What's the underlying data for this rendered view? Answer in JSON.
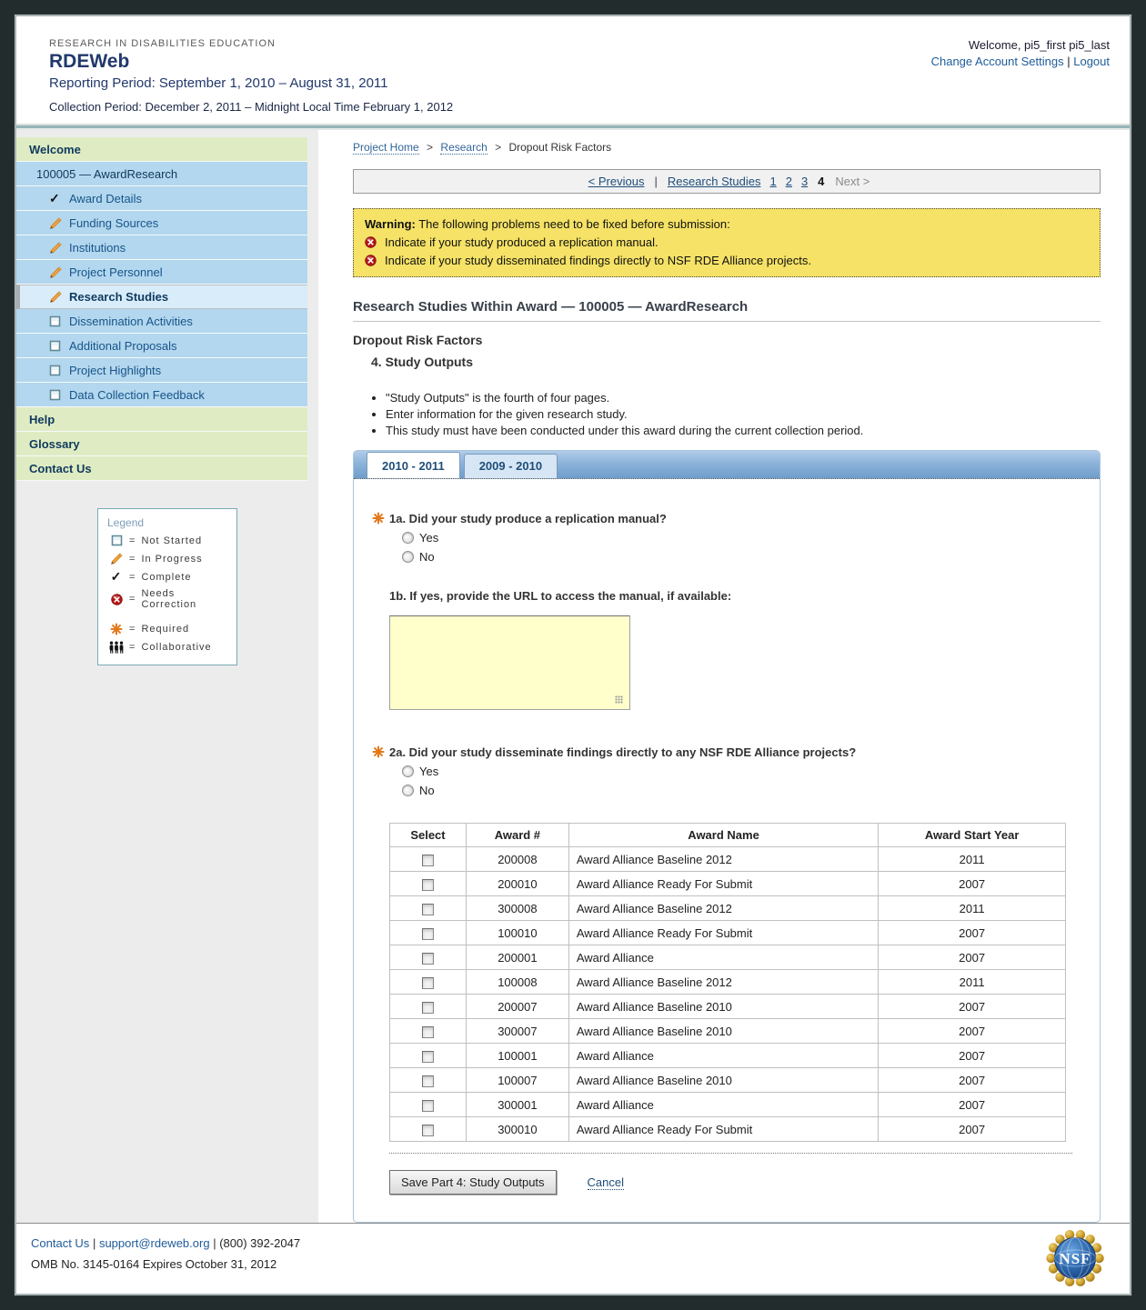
{
  "header": {
    "eyebrow": "RESEARCH IN DISABILITIES EDUCATION",
    "app_title": "RDEWeb",
    "reporting_period": "Reporting Period: September 1, 2010 – August 31, 2011",
    "collection_period": "Collection Period: December 2, 2011 – Midnight Local Time February 1, 2012",
    "welcome": "Welcome, pi5_first pi5_last",
    "account_settings_link": "Change Account Settings",
    "link_separator": "|",
    "logout_link": "Logout"
  },
  "sidebar": {
    "items": [
      {
        "label": "Welcome",
        "type": "section"
      },
      {
        "label": "100005 — AwardResearch",
        "type": "award"
      },
      {
        "label": "Award Details",
        "type": "sub",
        "icon": "complete"
      },
      {
        "label": "Funding Sources",
        "type": "sub",
        "icon": "in-progress"
      },
      {
        "label": "Institutions",
        "type": "sub",
        "icon": "in-progress"
      },
      {
        "label": "Project Personnel",
        "type": "sub",
        "icon": "in-progress"
      },
      {
        "label": "Research Studies",
        "type": "sub",
        "icon": "in-progress",
        "selected": true
      },
      {
        "label": "Dissemination Activities",
        "type": "sub",
        "icon": "not-started"
      },
      {
        "label": "Additional Proposals",
        "type": "sub",
        "icon": "not-started"
      },
      {
        "label": "Project Highlights",
        "type": "sub",
        "icon": "not-started"
      },
      {
        "label": "Data Collection Feedback",
        "type": "sub",
        "icon": "not-started"
      },
      {
        "label": "Help",
        "type": "section"
      },
      {
        "label": "Glossary",
        "type": "section"
      },
      {
        "label": "Contact Us",
        "type": "section"
      }
    ]
  },
  "legend": {
    "title": "Legend",
    "equals": "=",
    "items": [
      {
        "icon": "not-started",
        "label": "Not Started",
        "gap": false
      },
      {
        "icon": "in-progress",
        "label": "In Progress",
        "gap": false
      },
      {
        "icon": "complete",
        "label": "Complete",
        "gap": false
      },
      {
        "icon": "needs-correction",
        "label": "Needs Correction",
        "gap": false
      },
      {
        "icon": "required",
        "label": "Required",
        "gap": true
      },
      {
        "icon": "collaborative",
        "label": "Collaborative",
        "gap": false
      }
    ]
  },
  "breadcrumb": {
    "home": "Project Home",
    "research": "Research",
    "separator": ">",
    "current": "Dropout Risk Factors"
  },
  "pagination": {
    "previous": "< Previous",
    "pipe": "|",
    "studies_link": "Research Studies",
    "pages": [
      "1",
      "2",
      "3"
    ],
    "current_page": "4",
    "next": "Next >"
  },
  "warning": {
    "title": "Warning:",
    "intro": " The following problems need to be fixed before submission:",
    "items": [
      "Indicate if your study produced a replication manual.",
      "Indicate if your study disseminated findings directly to NSF RDE Alliance projects."
    ]
  },
  "main": {
    "section_title": "Research Studies Within Award — 100005 — AwardResearch",
    "study_title": "Dropout Risk Factors",
    "page_part_title": "4. Study Outputs",
    "bullets": [
      "\"Study Outputs\" is the fourth of four pages.",
      "Enter information for the given research study.",
      "This study must have been conducted under this award during the current collection period."
    ],
    "tabs": [
      {
        "label": "2010 - 2011",
        "active": true
      },
      {
        "label": "2009 - 2010",
        "active": false
      }
    ],
    "q1a": {
      "label": "1a. Did your study produce a replication manual?",
      "options": [
        "Yes",
        "No"
      ],
      "selected": null,
      "required": true
    },
    "q1b": {
      "label": "1b. If yes, provide the URL to access the manual, if available:",
      "value": ""
    },
    "q2a": {
      "label": "2a. Did your study disseminate findings directly to any NSF RDE Alliance projects?",
      "options": [
        "Yes",
        "No"
      ],
      "selected": null,
      "required": true
    },
    "awards_table": {
      "headers": [
        "Select",
        "Award #",
        "Award Name",
        "Award Start Year"
      ],
      "rows": [
        {
          "award_number": "200008",
          "award_name": "Award Alliance Baseline 2012",
          "start_year": "2011",
          "checked": false
        },
        {
          "award_number": "200010",
          "award_name": "Award Alliance Ready For Submit",
          "start_year": "2007",
          "checked": false
        },
        {
          "award_number": "300008",
          "award_name": "Award Alliance Baseline 2012",
          "start_year": "2011",
          "checked": false
        },
        {
          "award_number": "100010",
          "award_name": "Award Alliance Ready For Submit",
          "start_year": "2007",
          "checked": false
        },
        {
          "award_number": "200001",
          "award_name": "Award Alliance",
          "start_year": "2007",
          "checked": false
        },
        {
          "award_number": "100008",
          "award_name": "Award Alliance Baseline 2012",
          "start_year": "2011",
          "checked": false
        },
        {
          "award_number": "200007",
          "award_name": "Award Alliance Baseline 2010",
          "start_year": "2007",
          "checked": false
        },
        {
          "award_number": "300007",
          "award_name": "Award Alliance Baseline 2010",
          "start_year": "2007",
          "checked": false
        },
        {
          "award_number": "100001",
          "award_name": "Award Alliance",
          "start_year": "2007",
          "checked": false
        },
        {
          "award_number": "100007",
          "award_name": "Award Alliance Baseline 2010",
          "start_year": "2007",
          "checked": false
        },
        {
          "award_number": "300001",
          "award_name": "Award Alliance",
          "start_year": "2007",
          "checked": false
        },
        {
          "award_number": "300010",
          "award_name": "Award Alliance Ready For Submit",
          "start_year": "2007",
          "checked": false
        }
      ]
    },
    "save_button": "Save Part 4: Study Outputs",
    "cancel_link": "Cancel"
  },
  "footer": {
    "contact_link": "Contact Us",
    "email_link": "support@rdeweb.org",
    "phone": "(800) 392-2047",
    "separator": "|",
    "omb": "OMB No. 3145-0164 Expires October 31, 2012",
    "nsf_logo_text": "NSF"
  },
  "colors": {
    "outer_background": "#222c2c",
    "sidebar_section_green": "#dfecc3",
    "sidebar_item_blue": "#b3d7ee",
    "sidebar_selected_blue": "#d9ecfa",
    "navy_text": "#21386b",
    "link_blue": "#1f5c99",
    "warning_yellow": "#f5e266",
    "error_red": "#b51616",
    "required_orange": "#e2791c",
    "tab_strip_blue": "#8db3da",
    "textarea_yellow": "#ffffcc"
  }
}
